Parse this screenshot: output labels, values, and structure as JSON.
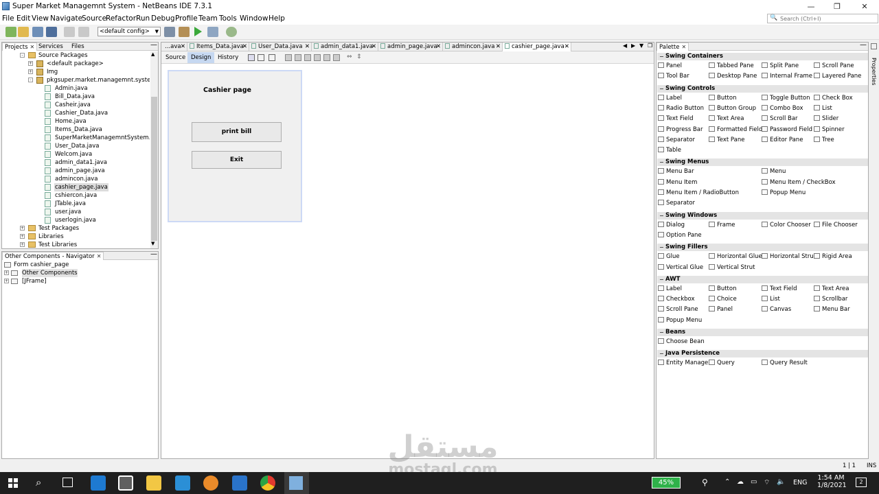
{
  "window": {
    "title": "Super Market Managemnt System - NetBeans IDE 7.3.1"
  },
  "menubar": [
    "File",
    "Edit",
    "View",
    "Navigate",
    "Source",
    "Refactor",
    "Run",
    "Debug",
    "Profile",
    "Team",
    "Tools",
    "Window",
    "Help"
  ],
  "search": {
    "placeholder": "Search (Ctrl+I)"
  },
  "toolbar": {
    "config": "<default config>"
  },
  "projects": {
    "tabs": [
      "Projects",
      "Services",
      "Files"
    ],
    "tree": [
      {
        "label": "Source Packages",
        "level": 1,
        "type": "folder",
        "exp": "-"
      },
      {
        "label": "<default package>",
        "level": 2,
        "type": "pkg",
        "exp": "+"
      },
      {
        "label": "Img",
        "level": 2,
        "type": "pkg",
        "exp": "+"
      },
      {
        "label": "pkgsuper.market.managemnt.system",
        "level": 2,
        "type": "pkg",
        "exp": "-"
      },
      {
        "label": "Admin.java",
        "level": 3,
        "type": "file"
      },
      {
        "label": "Bill_Data.java",
        "level": 3,
        "type": "file"
      },
      {
        "label": "Casheir.java",
        "level": 3,
        "type": "file"
      },
      {
        "label": "Cashier_Data.java",
        "level": 3,
        "type": "file"
      },
      {
        "label": "Home.java",
        "level": 3,
        "type": "file"
      },
      {
        "label": "Items_Data.java",
        "level": 3,
        "type": "file"
      },
      {
        "label": "SuperMarketManagemntSystem.java",
        "level": 3,
        "type": "file"
      },
      {
        "label": "User_Data.java",
        "level": 3,
        "type": "file"
      },
      {
        "label": "Welcom.java",
        "level": 3,
        "type": "file"
      },
      {
        "label": "admin_data1.java",
        "level": 3,
        "type": "file"
      },
      {
        "label": "admin_page.java",
        "level": 3,
        "type": "file"
      },
      {
        "label": "admincon.java",
        "level": 3,
        "type": "file"
      },
      {
        "label": "cashier_page.java",
        "level": 3,
        "type": "file",
        "selected": true
      },
      {
        "label": "cshiercon.java",
        "level": 3,
        "type": "file"
      },
      {
        "label": "JTable.java",
        "level": 3,
        "type": "file"
      },
      {
        "label": "user.java",
        "level": 3,
        "type": "file"
      },
      {
        "label": "userlogin.java",
        "level": 3,
        "type": "file"
      },
      {
        "label": "Test Packages",
        "level": 1,
        "type": "folder",
        "exp": "+"
      },
      {
        "label": "Libraries",
        "level": 1,
        "type": "folder",
        "exp": "+"
      },
      {
        "label": "Test Libraries",
        "level": 1,
        "type": "folder",
        "exp": "+"
      }
    ]
  },
  "navigator": {
    "tab": "Other Components - Navigator",
    "tree": [
      {
        "label": "Form cashier_page",
        "level": 0
      },
      {
        "label": "Other Components",
        "level": 1
      },
      {
        "label": "[JFrame]",
        "level": 1
      }
    ]
  },
  "editor": {
    "tabs": [
      "...ava",
      "Items_Data.java",
      "User_Data.java",
      "admin_data1.java",
      "admin_page.java",
      "admincon.java",
      "cashier_page.java"
    ],
    "subtabs": [
      "Source",
      "Design",
      "History"
    ],
    "form": {
      "title": "Cashier page",
      "buttons": [
        "print bill",
        "Exit"
      ]
    }
  },
  "palette": {
    "title": "Palette",
    "sections": [
      {
        "name": "Swing Containers",
        "items": [
          "Panel",
          "Tabbed Pane",
          "Split Pane",
          "Scroll Pane",
          "Tool Bar",
          "Desktop Pane",
          "Internal Frame",
          "Layered Pane"
        ],
        "cols": 4
      },
      {
        "name": "Swing Controls",
        "items": [
          "Label",
          "Button",
          "Toggle Button",
          "Check Box",
          "Radio Button",
          "Button Group",
          "Combo Box",
          "List",
          "Text Field",
          "Text Area",
          "Scroll Bar",
          "Slider",
          "Progress Bar",
          "Formatted Field",
          "Password Field",
          "Spinner",
          "Separator",
          "Text Pane",
          "Editor Pane",
          "Tree",
          "Table"
        ],
        "cols": 4
      },
      {
        "name": "Swing Menus",
        "items": [
          "Menu Bar",
          "Menu",
          "Menu Item",
          "Menu Item / CheckBox",
          "Menu Item / RadioButton",
          "Popup Menu",
          "Separator"
        ],
        "cols": 2
      },
      {
        "name": "Swing Windows",
        "items": [
          "Dialog",
          "Frame",
          "Color Chooser",
          "File Chooser",
          "Option Pane"
        ],
        "cols": 4
      },
      {
        "name": "Swing Fillers",
        "items": [
          "Glue",
          "Horizontal Glue",
          "Horizontal Strut",
          "Rigid Area",
          "Vertical Glue",
          "Vertical Strut"
        ],
        "cols": 4
      },
      {
        "name": "AWT",
        "items": [
          "Label",
          "Button",
          "Text Field",
          "Text Area",
          "Checkbox",
          "Choice",
          "List",
          "Scrollbar",
          "Scroll Pane",
          "Panel",
          "Canvas",
          "Menu Bar",
          "Popup Menu"
        ],
        "cols": 4
      },
      {
        "name": "Beans",
        "items": [
          "Choose Bean"
        ],
        "cols": 4
      },
      {
        "name": "Java Persistence",
        "items": [
          "Entity Manager",
          "Query",
          "Query Result"
        ],
        "cols": 4
      }
    ]
  },
  "properties": {
    "label": "Properties"
  },
  "status": {
    "position": "1 | 1",
    "mode": "INS"
  },
  "taskbar": {
    "battery": "45%",
    "lang": "ENG",
    "time": "1:54 AM",
    "date": "1/8/2021",
    "notif": "2"
  },
  "watermark": {
    "arabic": "مستقل",
    "latin": "mostaql.com"
  }
}
